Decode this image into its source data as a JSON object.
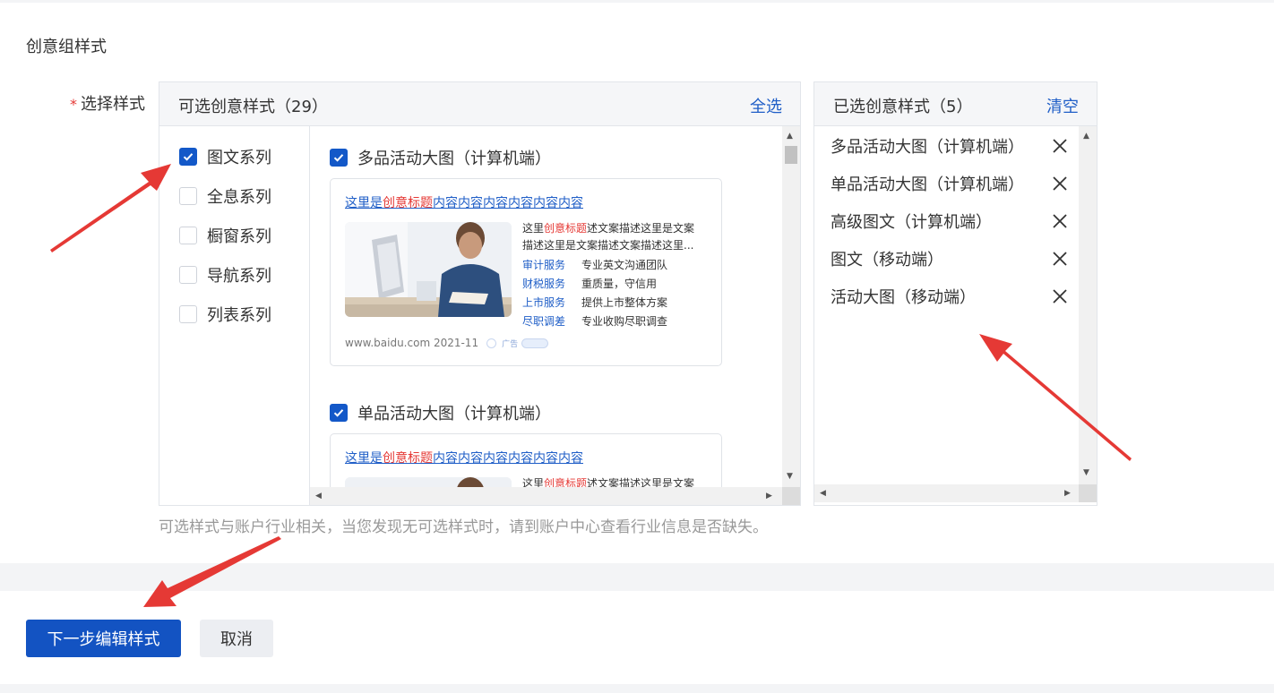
{
  "section": {
    "title": "创意组样式"
  },
  "form": {
    "required_mark": "*",
    "label": "选择样式"
  },
  "available": {
    "title": "可选创意样式（29）",
    "select_all": "全选",
    "series": [
      {
        "label": "图文系列",
        "checked": true
      },
      {
        "label": "全息系列",
        "checked": false
      },
      {
        "label": "橱窗系列",
        "checked": false
      },
      {
        "label": "导航系列",
        "checked": false
      },
      {
        "label": "列表系列",
        "checked": false
      }
    ],
    "styles": [
      {
        "label": "多品活动大图（计算机端）",
        "checked": true
      },
      {
        "label": "单品活动大图（计算机端）",
        "checked": true
      }
    ]
  },
  "preview": {
    "title_a": "这里是",
    "title_red": "创意标题",
    "title_b": "内容内容内容内容内容内容",
    "desc_a": "这里",
    "desc_red": "创意标题",
    "desc_b": "述文案描述这里是文案",
    "desc_line2": "描述这里是文案描述文案描述这里...",
    "links": [
      {
        "k": "审计服务",
        "v": "专业英文沟通团队"
      },
      {
        "k": "财税服务",
        "v": "重质量，守信用"
      },
      {
        "k": "上市服务",
        "v": "提供上市整体方案"
      },
      {
        "k": "尽职调差",
        "v": "专业收购尽职调查"
      }
    ],
    "url": "www.baidu.com 2021-11",
    "ad": "广告"
  },
  "selected": {
    "title": "已选创意样式（5）",
    "clear": "清空",
    "items": [
      "多品活动大图（计算机端）",
      "单品活动大图（计算机端）",
      "高级图文（计算机端）",
      "图文（移动端）",
      "活动大图（移动端）"
    ]
  },
  "hint": "可选样式与账户行业相关，当您发现无可选样式时，请到账户中心查看行业信息是否缺失。",
  "actions": {
    "next": "下一步编辑样式",
    "cancel": "取消"
  },
  "colors": {
    "primary": "#1353c2",
    "link": "#1f5ec7",
    "highlight": "#e53935",
    "annotation": "#e53935"
  }
}
